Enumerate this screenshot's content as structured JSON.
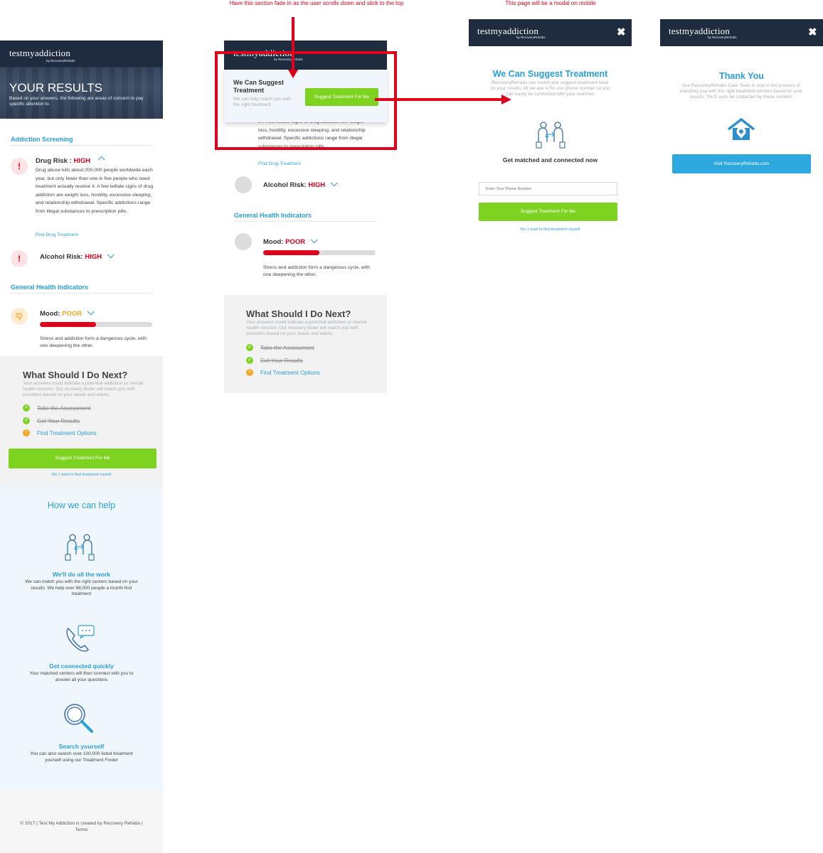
{
  "annotations": {
    "sticky_note": "Have this section fade in as the user scrolls down and stick to the top",
    "modal_note": "This page will be a modal on mobile"
  },
  "brand": {
    "logo": "testmyaddiction",
    "logo_sub": "by RecoveryRehabs"
  },
  "results": {
    "title": "YOUR RESULTS",
    "subtitle": "Based on your answers, the following are areas of concern to pay specific attention to.",
    "addiction_section": "Addiction Screening",
    "drug_label": "Drug Risk :",
    "drug_level": "HIGH",
    "drug_desc": "Drug abuse kills about 200,000 people worldwide each year, but only fewer than one in five people who need treatment actually receive it. A few telltale signs of drug addiction are weight loss, hostility, excessive sleeping, and relationship withdrawal. Specific addictions range from illegal substances to prescription pills.",
    "drug_link": "Find Drug Treatment",
    "alcohol_label": "Alcohol Risk:",
    "alcohol_level": "HIGH",
    "general_section": "General Health Indicators",
    "mood_label": "Mood:",
    "mood_level": "POOR",
    "mood_progress_pct": 50,
    "mood_desc": "Stress and addiction form a dangerous cycle, with one deepening the other."
  },
  "next_steps": {
    "title": "What Should I Do Next?",
    "desc": "Your answers could indicate a potential addiction or mental health concern. Our recovery finder will match you with providers based on your needs and wants.",
    "steps": [
      {
        "label": "Take the Assessment",
        "status": "done"
      },
      {
        "label": "Get Your Results",
        "status": "done"
      },
      {
        "label": "Find Treatment Options",
        "status": "todo"
      }
    ],
    "cta": "Suggest Treatment For Me",
    "decline": "No, I want to find treatment  myself"
  },
  "help": {
    "title": "How we can help",
    "features": [
      {
        "icon": "matching-people-icon",
        "title": "We'll do all the work",
        "desc": "We can match you with the right centers based on your results. We help over 68,000 people a month find treatment"
      },
      {
        "icon": "phone-chat-icon",
        "title": "Get connected quickly",
        "desc": "Your matched centers will then connect with you to answer all your questions"
      },
      {
        "icon": "magnifier-icon",
        "title": "Search yourself",
        "desc": "You can also search over 100,000 listed treatment yourself using our Treatment Finder"
      }
    ]
  },
  "footer": {
    "text": "© 2017 | Test My Addiction is created by Recovery Rehabs | Terms"
  },
  "sticky": {
    "title": "We Can Suggest Treatment",
    "sub": "We can help match you with the right treatment",
    "button": "Suggest Treatment For Me",
    "partial_desc": "it. A few telltale signs of drug addiction are weight loss, hostility, excessive sleeping, and relationship withdrawal. Specific addictions range from illegal substances to prescription pills."
  },
  "modal": {
    "title": "We Can Suggest Treatment",
    "desc": "RecoveryRehabs can match and suggest treatment base on your results. All we ask is for you phone number so you can easily be connected with your matches",
    "connect": "Get matched and connected now",
    "phone_placeholder": "Enter Your Phone Number",
    "button": "Suggest Treatment For Me",
    "decline": "No, I want to find treatment myself"
  },
  "thanks": {
    "title": "Thank You",
    "desc": "Our RecoveryRehabs Care Team is now in the process of matching you with the right treatment centers based on your results. You'll soon be contacted by these centers!",
    "button": "Visit RecoveryRehabs.com"
  },
  "colors": {
    "header": "#1f2b3e",
    "accent_blue": "#2a9fd8",
    "green": "#7ed321",
    "red": "#e0001b",
    "orange": "#f5a623"
  }
}
